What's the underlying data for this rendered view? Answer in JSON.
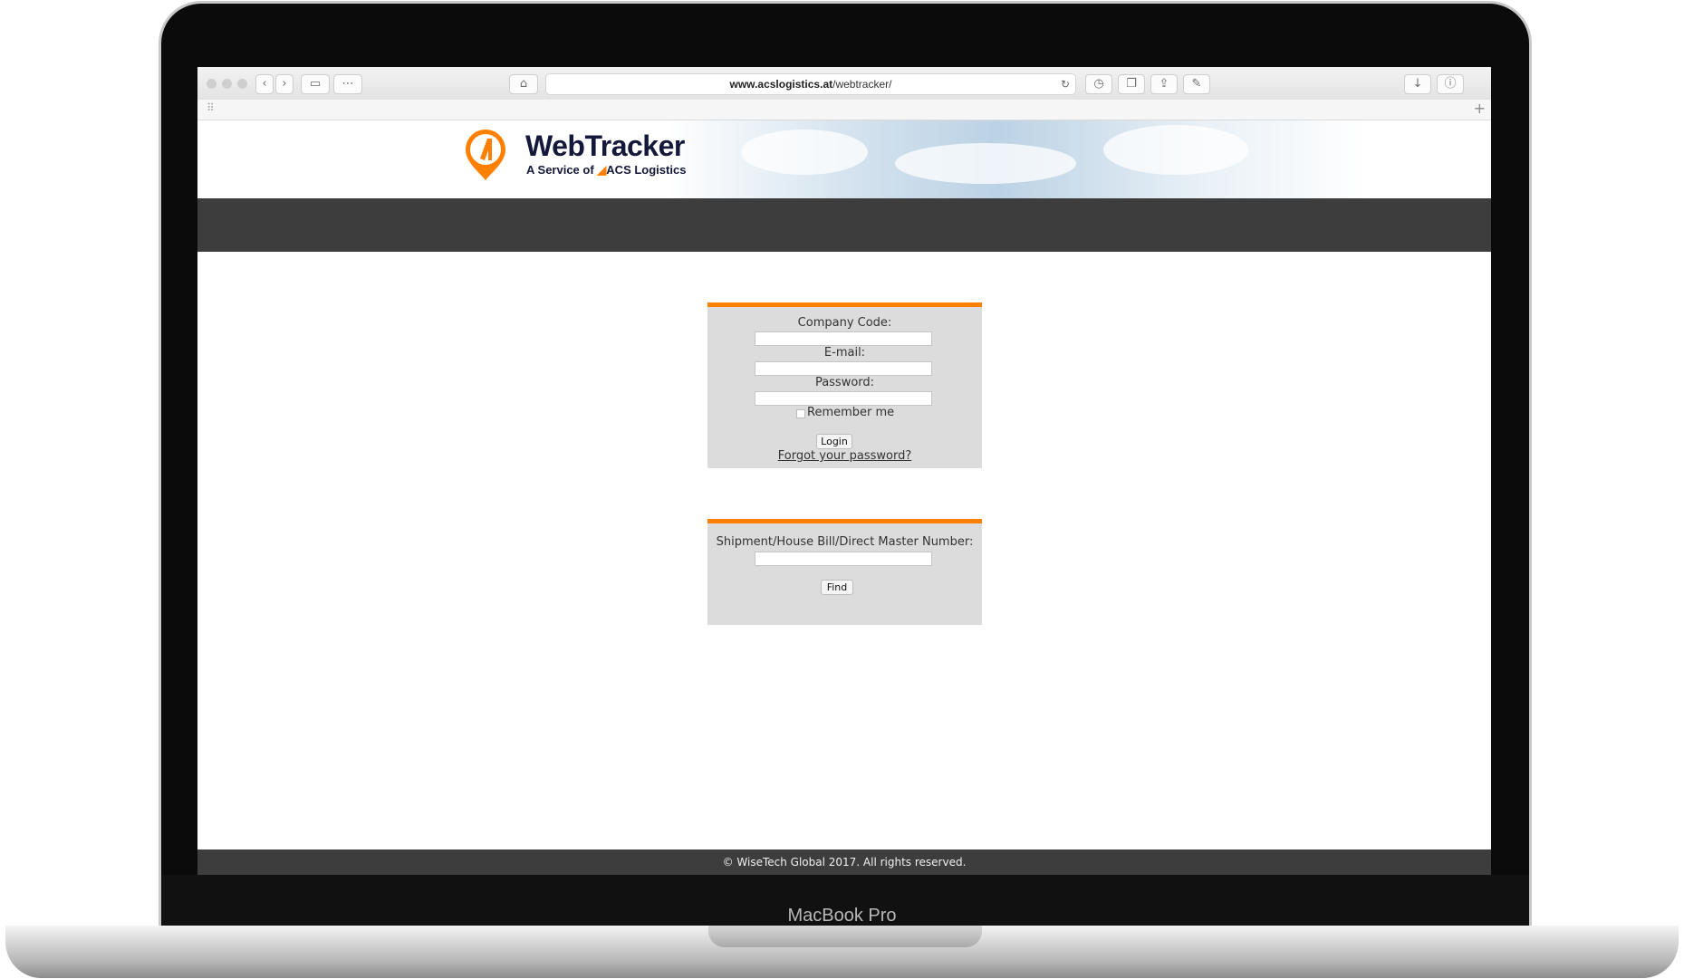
{
  "browser": {
    "url_domain": "www.acslogistics.at",
    "url_path": "/webtracker/",
    "toolbar_icons": [
      "back-icon",
      "forward-icon",
      "sidebar-icon",
      "grid-icon",
      "home-icon",
      "reload-icon",
      "history-icon",
      "tabs-icon",
      "share-icon",
      "edit-icon",
      "download-icon",
      "info-icon",
      "new-tab-icon"
    ]
  },
  "brand": {
    "name": "WebTracker",
    "sub_prefix": "A Service of",
    "sub_company": "ACS Logistics",
    "accent_color": "#ff8000",
    "navy_color": "#14183a"
  },
  "login": {
    "company_code_label": "Company Code:",
    "email_label": "E-mail:",
    "password_label": "Password:",
    "remember_label": "Remember me",
    "login_button": "Login",
    "forgot_link": "Forgot your password?"
  },
  "shipment": {
    "label": "Shipment/House Bill/Direct Master Number:",
    "find_button": "Find"
  },
  "footer": {
    "copyright": "© WiseTech Global 2017. All rights reserved."
  },
  "device": {
    "model": "MacBook Pro"
  }
}
